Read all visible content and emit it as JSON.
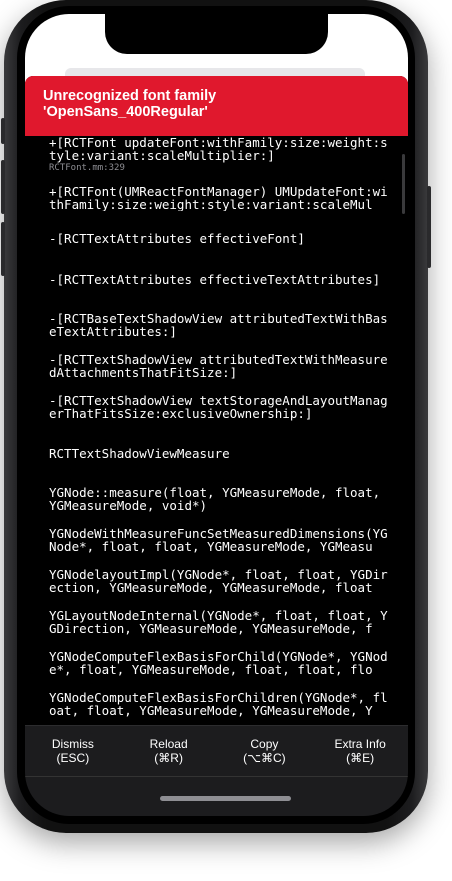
{
  "error": {
    "title_line1": "Unrecognized font family",
    "title_line2": "'OpenSans_400Regular'"
  },
  "stack_frames": [
    {
      "method": "+[RCTFont updateFont:withFamily:size:weight:style:variant:scaleMultiplier:]",
      "file": "RCTFont.mm:329"
    },
    {
      "method": "+[RCTFont(UMReactFontManager) UMUpdateFont:withFamily:size:weight:style:variant:scaleMul",
      "file": ""
    },
    {
      "method": "-[RCTTextAttributes effectiveFont]",
      "file": ""
    },
    {
      "method": "-[RCTTextAttributes effectiveTextAttributes]",
      "file": ""
    },
    {
      "method": "-[RCTBaseTextShadowView attributedTextWithBaseTextAttributes:]",
      "file": ""
    },
    {
      "method": "-[RCTTextShadowView attributedTextWithMeasuredAttachmentsThatFitSize:]",
      "file": ""
    },
    {
      "method": "-[RCTTextShadowView textStorageAndLayoutManagerThatFitsSize:exclusiveOwnership:]",
      "file": ""
    },
    {
      "method": "RCTTextShadowViewMeasure",
      "file": ""
    },
    {
      "method": "YGNode::measure(float, YGMeasureMode, float, YGMeasureMode, void*)",
      "file": ""
    },
    {
      "method": "YGNodeWithMeasureFuncSetMeasuredDimensions(YGNode*, float, float, YGMeasureMode, YGMeasu",
      "file": ""
    },
    {
      "method": "YGNodelayoutImpl(YGNode*, float, float, YGDirection, YGMeasureMode, YGMeasureMode, float",
      "file": ""
    },
    {
      "method": "YGLayoutNodeInternal(YGNode*, float, float, YGDirection, YGMeasureMode, YGMeasureMode, f",
      "file": ""
    },
    {
      "method": "YGNodeComputeFlexBasisForChild(YGNode*, YGNode*, float, YGMeasureMode, float, float, flo",
      "file": ""
    },
    {
      "method": "YGNodeComputeFlexBasisForChildren(YGNode*, float, float, YGMeasureMode, YGMeasureMode, Y",
      "file": ""
    }
  ],
  "toolbar": {
    "dismiss_label": "Dismiss",
    "dismiss_shortcut": "(ESC)",
    "reload_label": "Reload",
    "reload_shortcut": "(⌘R)",
    "copy_label": "Copy",
    "copy_shortcut": "(⌥⌘C)",
    "extra_label": "Extra Info",
    "extra_shortcut": "(⌘E)"
  },
  "colors": {
    "error_red": "#e0182d",
    "background": "#000000",
    "toolbar": "#1c1c1e"
  }
}
